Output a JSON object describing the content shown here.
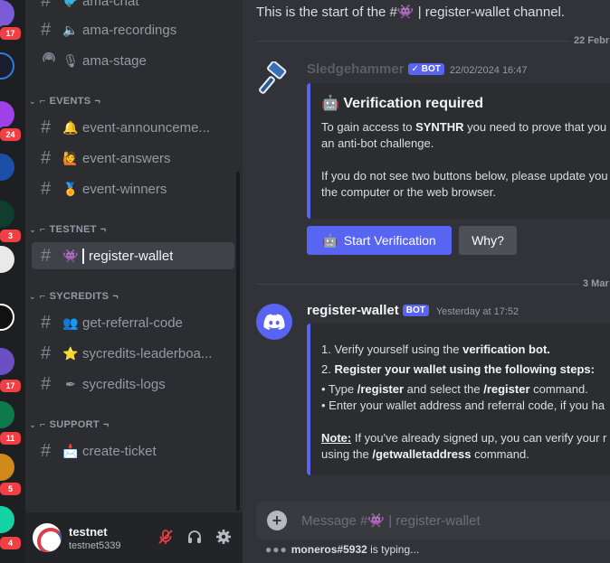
{
  "servers": [
    {
      "badge": "17"
    },
    {
      "badge": ""
    },
    {
      "badge": "24"
    },
    {
      "badge": ""
    },
    {
      "badge": "3"
    },
    {
      "badge": ""
    },
    {
      "badge": ""
    },
    {
      "badge": "17"
    },
    {
      "badge": "11"
    },
    {
      "badge": "5"
    },
    {
      "badge": "4"
    }
  ],
  "sidebar": {
    "channels_top": [
      {
        "emoji": "🐦",
        "label": "ama-chat",
        "icon": "hash-icon"
      },
      {
        "emoji": "🔈",
        "label": "ama-recordings",
        "icon": "hash-icon"
      },
      {
        "emoji": "🎙",
        "label": "ama-stage",
        "icon": "stage-icon"
      }
    ],
    "categories": {
      "events": "EVENTS",
      "testnet": "TESTNET",
      "sycredits": "SYCREDITS",
      "support": "SUPPORT"
    },
    "events": [
      {
        "emoji": "🔔",
        "label": "event-announceme..."
      },
      {
        "emoji": "🙋",
        "label": "event-answers"
      },
      {
        "emoji": "🏅",
        "label": "event-winners"
      }
    ],
    "testnet": [
      {
        "emoji": "👾",
        "label": "register-wallet"
      }
    ],
    "sycredits": [
      {
        "emoji": "👥",
        "label": "get-referral-code"
      },
      {
        "emoji": "⭐",
        "label": "sycredits-leaderboa..."
      },
      {
        "emoji": "✒",
        "label": "sycredits-logs"
      }
    ],
    "support": [
      {
        "emoji": "📩",
        "label": "create-ticket"
      }
    ]
  },
  "user": {
    "name": "testnet",
    "tag": "testnet5339"
  },
  "main": {
    "start_text": "This is the start of the #👾 | register-wallet channel.",
    "divider1": "22 Febr",
    "divider2": "3 Mar",
    "message1": {
      "author": "Sledgehammer",
      "badge": "BOT",
      "timestamp": "22/02/2024 16:47",
      "embed_title": "🤖 Verification required",
      "line1_pre": "To gain access to ",
      "line1_bold": "SYNTHR",
      "line1_post": " you need to prove that you",
      "line2": "an anti-bot challenge.",
      "line3": "If you do not see two buttons below, please update you",
      "line4": "the computer or the web browser.",
      "button_verify": "Start Verification",
      "button_verify_emoji": "🤖",
      "button_why": "Why?"
    },
    "message2": {
      "author": "register-wallet",
      "badge": "BOT",
      "timestamp": "Yesterday at 17:52",
      "l1_pre": "1. Verify yourself using the ",
      "l1_bold": "verification bot.",
      "l2_pre": "2. ",
      "l2_bold": "Register your wallet using the following steps:",
      "l3_pre": "• Type ",
      "l3_b1": "/register",
      "l3_mid": " and select the ",
      "l3_b2": "/register",
      "l3_post": " command.",
      "l4": "• Enter your wallet address and referral code, if you ha",
      "l5_bold": "Note:",
      "l5_post": " If you've already signed up, you can verify your r",
      "l6_pre": "using the ",
      "l6_bold": "/getwalletaddress",
      "l6_post": " command."
    },
    "composer_placeholder": "Message #👾 | register-wallet",
    "typing_user": "moneros#5932",
    "typing_text": " is typing..."
  }
}
